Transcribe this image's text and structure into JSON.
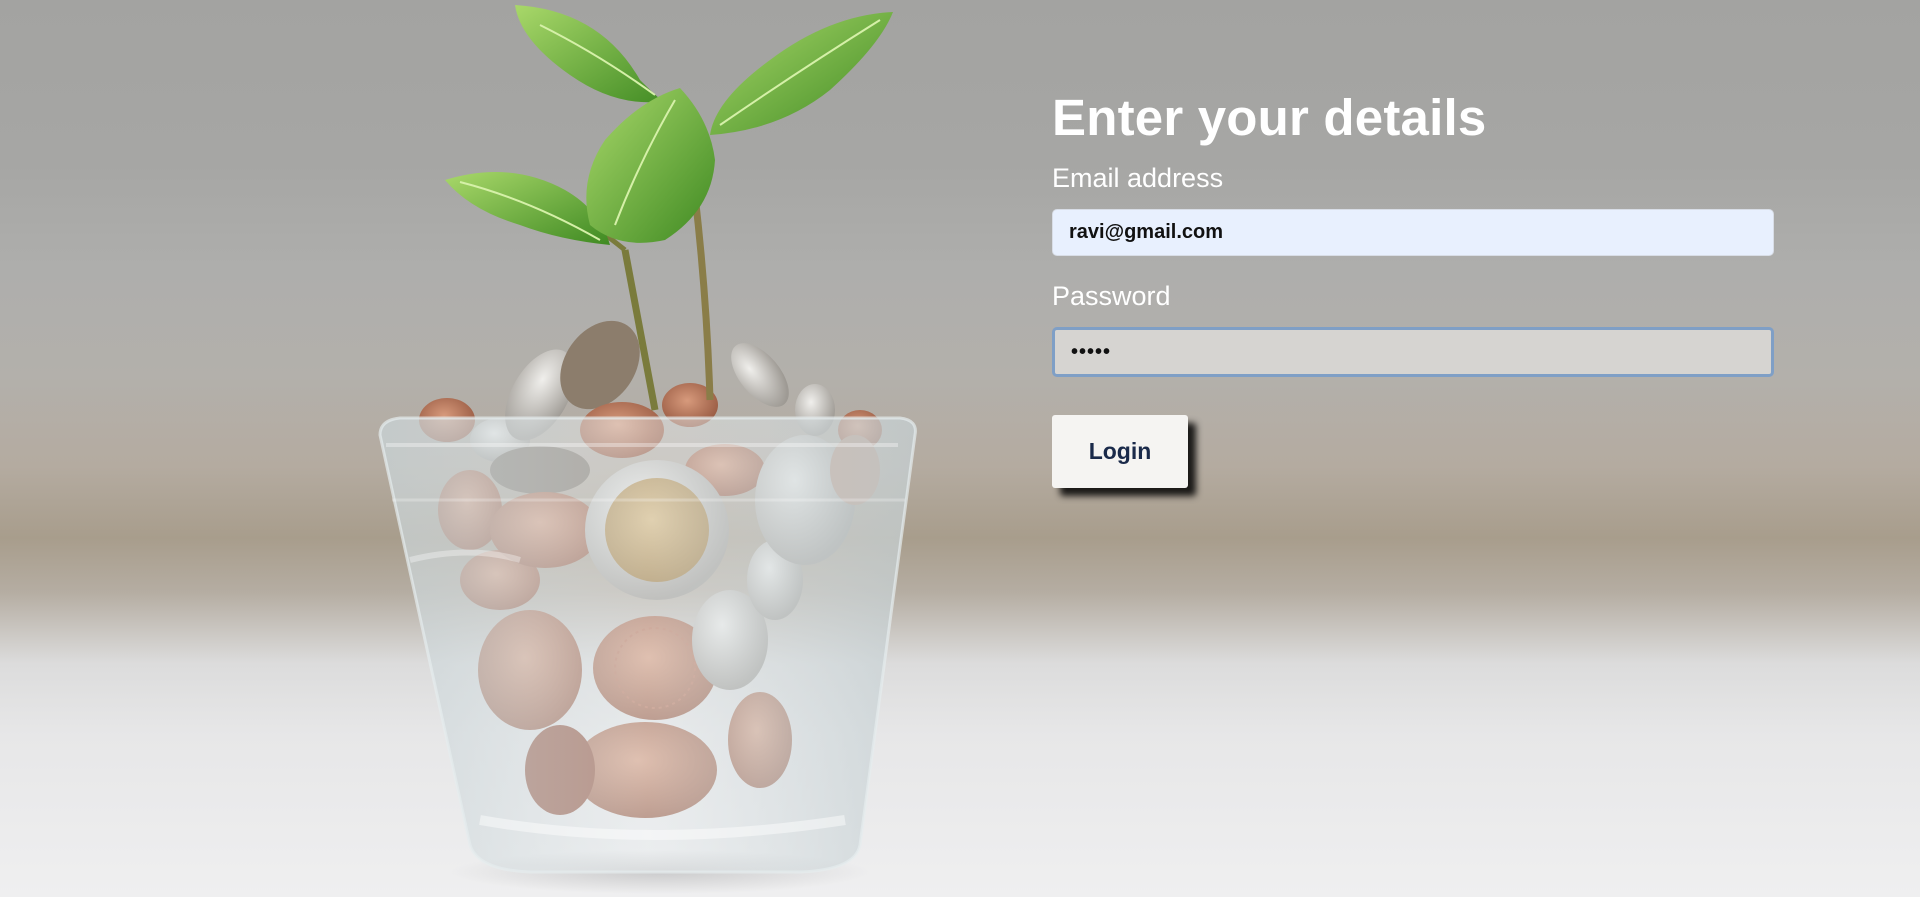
{
  "form": {
    "title": "Enter your details",
    "email_label": "Email address",
    "email_value": "ravi@gmail.com",
    "password_label": "Password",
    "password_value": "•••••",
    "login_label": "Login"
  },
  "hero_image": {
    "icon": "plant-in-coin-jar-photo"
  },
  "colors": {
    "title": "#ffffff",
    "email_field_bg": "#e8f0fe",
    "password_field_border": "#7f9fc6",
    "button_text": "#1a2a4a"
  }
}
